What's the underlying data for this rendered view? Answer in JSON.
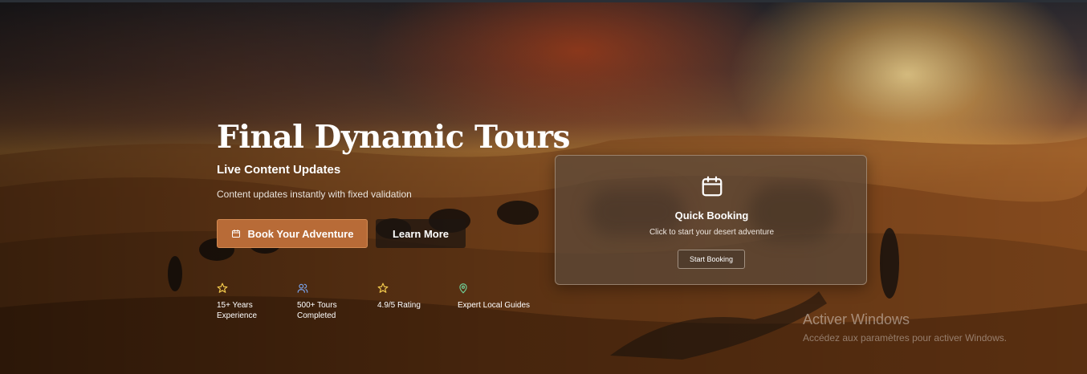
{
  "colors": {
    "primary_button": "#b86b37",
    "star_icon": "#f2c94c",
    "users_icon": "#7aa6f0",
    "pin_icon": "#6fcf97"
  },
  "hero": {
    "title": "Final Dynamic Tours",
    "subtitle": "Live Content Updates",
    "description": "Content updates instantly with fixed validation",
    "primary_button": {
      "label": "Book Your Adventure",
      "icon": "calendar-icon"
    },
    "secondary_button": {
      "label": "Learn More"
    }
  },
  "stats": [
    {
      "icon": "star-icon",
      "label": "15+ Years\nExperience"
    },
    {
      "icon": "users-icon",
      "label": "500+ Tours\nCompleted"
    },
    {
      "icon": "star-icon",
      "label": "4.9/5 Rating"
    },
    {
      "icon": "map-pin-icon",
      "label": "Expert Local Guides"
    }
  ],
  "booking_card": {
    "icon": "calendar-icon",
    "title": "Quick Booking",
    "subtitle": "Click to start your desert adventure",
    "button_label": "Start Booking"
  },
  "windows_watermark": {
    "title": "Activer Windows",
    "subtitle": "Accédez aux paramètres pour activer Windows."
  }
}
